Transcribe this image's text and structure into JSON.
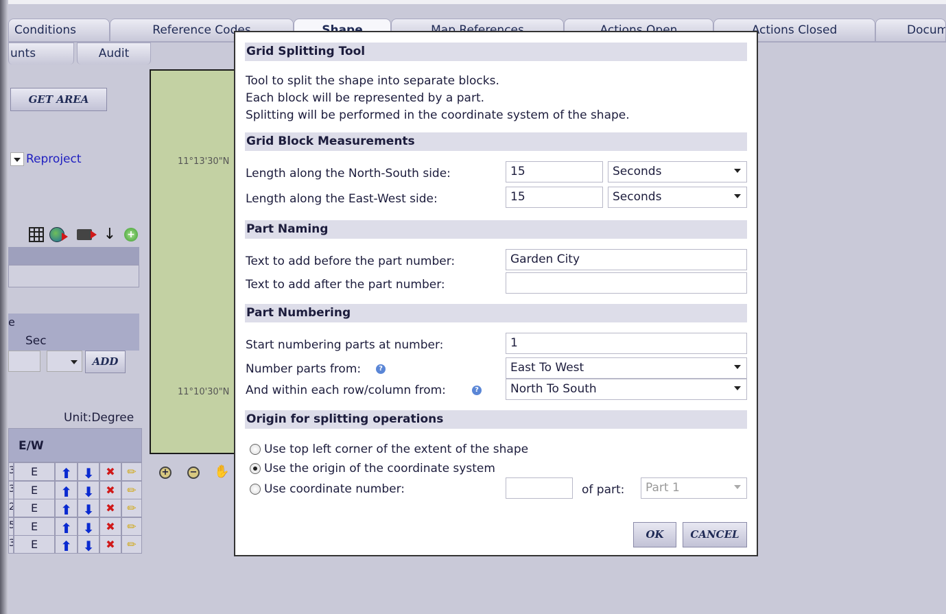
{
  "tabs": [
    "Conditions",
    "Reference Codes",
    "Shape",
    "Map References",
    "Actions Open",
    "Actions Closed",
    "Docum"
  ],
  "subtabs": [
    "unts",
    "Audit"
  ],
  "left": {
    "get_area": "GET AREA",
    "reproject": "Reproject",
    "sec_label": "Sec",
    "e_label": "e",
    "add": "ADD",
    "unit": "Unit:Degree",
    "ew_header": "E/W",
    "rows": [
      {
        "n": "3",
        "ew": "E"
      },
      {
        "n": "3",
        "ew": "E"
      },
      {
        "n": "2",
        "ew": "E"
      },
      {
        "n": "5",
        "ew": "E"
      },
      {
        "n": "3",
        "ew": "E"
      }
    ]
  },
  "map": {
    "lat_top": "11°13'30\"N",
    "lat_bottom": "11°10'30\"N"
  },
  "dialog": {
    "title": "Grid Splitting Tool",
    "desc": [
      "Tool to split the shape into separate blocks.",
      "Each block will be represented by a part.",
      "Splitting will be performed in the coordinate system of the shape."
    ],
    "measure": {
      "heading": "Grid Block Measurements",
      "ns_label": "Length along the North-South side:",
      "ns_value": "15",
      "ns_unit": "Seconds",
      "ew_label": "Length along the East-West side:",
      "ew_value": "15",
      "ew_unit": "Seconds"
    },
    "naming": {
      "heading": "Part Naming",
      "before_label": "Text to add before the part number:",
      "before_value": "Garden City",
      "after_label": "Text to add after the part number:",
      "after_value": ""
    },
    "numbering": {
      "heading": "Part Numbering",
      "start_label": "Start numbering parts at number:",
      "start_value": "1",
      "from_label": "Number parts from:",
      "from_value": "East To West",
      "within_label": "And within each row/column from:",
      "within_value": "North To South"
    },
    "origin": {
      "heading": "Origin for splitting operations",
      "opt1": "Use top left corner of the extent of the shape",
      "opt2": "Use the origin of the coordinate system",
      "opt3": "Use coordinate number:",
      "coord_value": "",
      "of_part": "of part:",
      "part_value": "Part 1",
      "selected": 2
    },
    "ok": "OK",
    "cancel": "CANCEL"
  },
  "colors": {
    "background": "#c9c9d8",
    "section": "#dddde9",
    "map": "#c3d1a3",
    "link": "#2020c0"
  }
}
